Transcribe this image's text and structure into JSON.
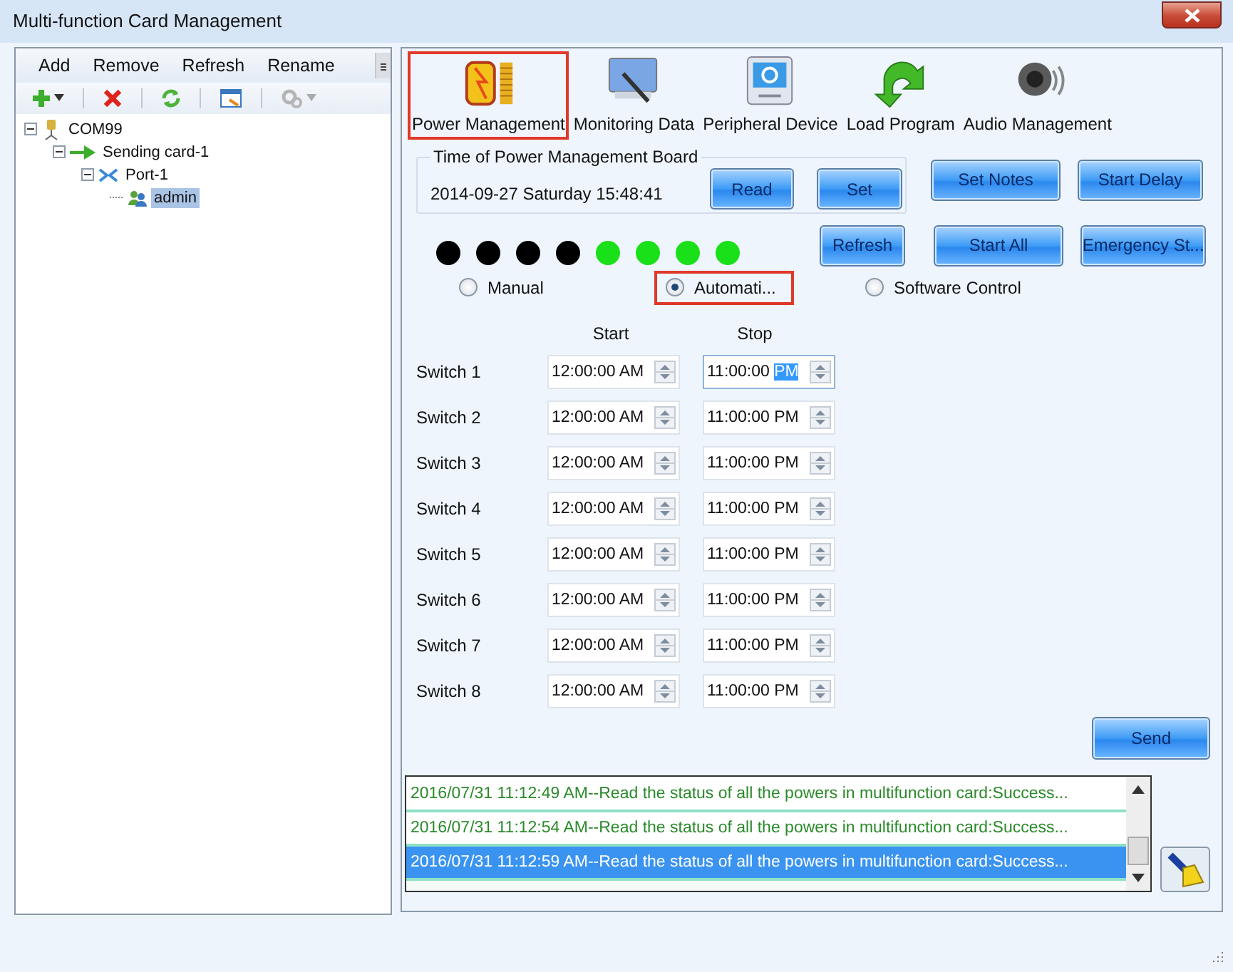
{
  "window": {
    "title": "Multi-function Card Management"
  },
  "tree_panel": {
    "menu": [
      "Add",
      "Remove",
      "Refresh",
      "Rename"
    ],
    "toolbar": [
      {
        "kind": "add",
        "disabled": false,
        "dropdown": true
      },
      {
        "kind": "remove",
        "disabled": false,
        "dropdown": false
      },
      {
        "kind": "refresh",
        "disabled": false,
        "dropdown": false
      },
      {
        "kind": "window",
        "disabled": false,
        "dropdown": false
      },
      {
        "kind": "gear",
        "disabled": true,
        "dropdown": true
      }
    ],
    "tree": [
      {
        "label": "COM99",
        "kind": "com",
        "selected": false,
        "expanded": true,
        "children": [
          {
            "label": "Sending card-1",
            "kind": "sender",
            "selected": false,
            "expanded": true,
            "children": [
              {
                "label": "Port-1",
                "kind": "port",
                "selected": false,
                "expanded": true,
                "children": [
                  {
                    "label": "admin",
                    "kind": "user",
                    "selected": true
                  }
                ]
              }
            ]
          }
        ]
      }
    ]
  },
  "tabs": [
    {
      "label": "Power Management",
      "kind": "battery",
      "selected": true
    },
    {
      "label": "Monitoring Data",
      "kind": "monitor",
      "selected": false
    },
    {
      "label": "Peripheral Device",
      "kind": "device",
      "selected": false
    },
    {
      "label": "Load Program",
      "kind": "arrow",
      "selected": false
    },
    {
      "label": "Audio Management",
      "kind": "speaker",
      "selected": false
    }
  ],
  "time_group": {
    "title": "Time of Power Management Board",
    "value": "2014-09-27 Saturday 15:48:41",
    "buttons": [
      "Read",
      "Set"
    ]
  },
  "buttons_top": [
    "Set Notes",
    "Start Delay"
  ],
  "buttons_row2": [
    "Refresh",
    "Start All",
    "Emergency St..."
  ],
  "lamps": [
    {
      "on": false
    },
    {
      "on": false
    },
    {
      "on": false
    },
    {
      "on": false
    },
    {
      "on": true
    },
    {
      "on": true
    },
    {
      "on": true
    },
    {
      "on": true
    }
  ],
  "modes": [
    {
      "label": "Manual",
      "selected": false,
      "highlighted": false
    },
    {
      "label": "Automati...",
      "selected": true,
      "highlighted": true
    },
    {
      "label": "Software Control",
      "selected": false,
      "highlighted": false
    }
  ],
  "switches": {
    "columns": [
      "Start",
      "Stop"
    ],
    "rows": [
      {
        "label": "Switch 1",
        "start": "12:00:00 AM",
        "stop": "11:00:00 PM",
        "stop_focused": true
      },
      {
        "label": "Switch 2",
        "start": "12:00:00 AM",
        "stop": "11:00:00 PM",
        "stop_focused": false
      },
      {
        "label": "Switch 3",
        "start": "12:00:00 AM",
        "stop": "11:00:00 PM",
        "stop_focused": false
      },
      {
        "label": "Switch 4",
        "start": "12:00:00 AM",
        "stop": "11:00:00 PM",
        "stop_focused": false
      },
      {
        "label": "Switch 5",
        "start": "12:00:00 AM",
        "stop": "11:00:00 PM",
        "stop_focused": false
      },
      {
        "label": "Switch 6",
        "start": "12:00:00 AM",
        "stop": "11:00:00 PM",
        "stop_focused": false
      },
      {
        "label": "Switch 7",
        "start": "12:00:00 AM",
        "stop": "11:00:00 PM",
        "stop_focused": false
      },
      {
        "label": "Switch 8",
        "start": "12:00:00 AM",
        "stop": "11:00:00 PM",
        "stop_focused": false
      }
    ]
  },
  "send_button": "Send",
  "log": [
    {
      "text": "2016/07/31 11:12:49 AM--Read the status of all the powers in multifunction card:Success...",
      "selected": false
    },
    {
      "text": "2016/07/31 11:12:54 AM--Read the status of all the powers in multifunction card:Success...",
      "selected": false
    },
    {
      "text": "2016/07/31 11:12:59 AM--Read the status of all the powers in multifunction card:Success...",
      "selected": true
    }
  ]
}
